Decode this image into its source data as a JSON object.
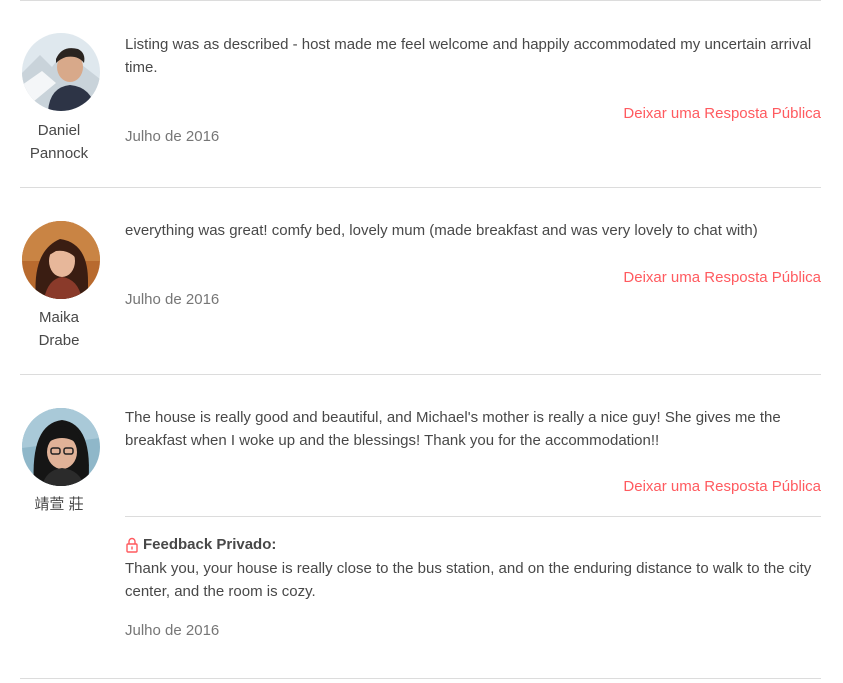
{
  "reviews": [
    {
      "author_first": "Daniel",
      "author_last": "Pannock",
      "avatar_icon": "user-avatar-photo",
      "comment": "Listing was as described - host made me feel welcome and happily accommodated my uncertain arrival time.",
      "reply_label": "Deixar uma Resposta Pública",
      "date": "Julho de 2016"
    },
    {
      "author_first": "Maika",
      "author_last": "Drabe",
      "avatar_icon": "user-avatar-photo",
      "comment": "everything was great! comfy bed, lovely mum (made breakfast and was very lovely to chat with)",
      "reply_label": "Deixar uma Resposta Pública",
      "date": "Julho de 2016"
    },
    {
      "author_first": "靖萱 莊",
      "author_last": "",
      "avatar_icon": "user-avatar-photo",
      "comment": "The house is really good and beautiful, and Michael's mother is really a nice guy! She gives me the breakfast when I woke up and the blessings! Thank you for the accommodation!!",
      "reply_label": "Deixar uma Resposta Pública",
      "private_feedback_title": "Feedback Privado:",
      "private_feedback_icon": "lock-icon",
      "private_feedback_text": "Thank you, your house is really close to the bus station, and on the enduring distance to walk to the city center, and the room is cozy.",
      "date": "Julho de 2016"
    }
  ],
  "colors": {
    "accent": "#ff5a5f",
    "text": "#484848",
    "muted": "#767676",
    "divider": "#dcdcdc"
  }
}
